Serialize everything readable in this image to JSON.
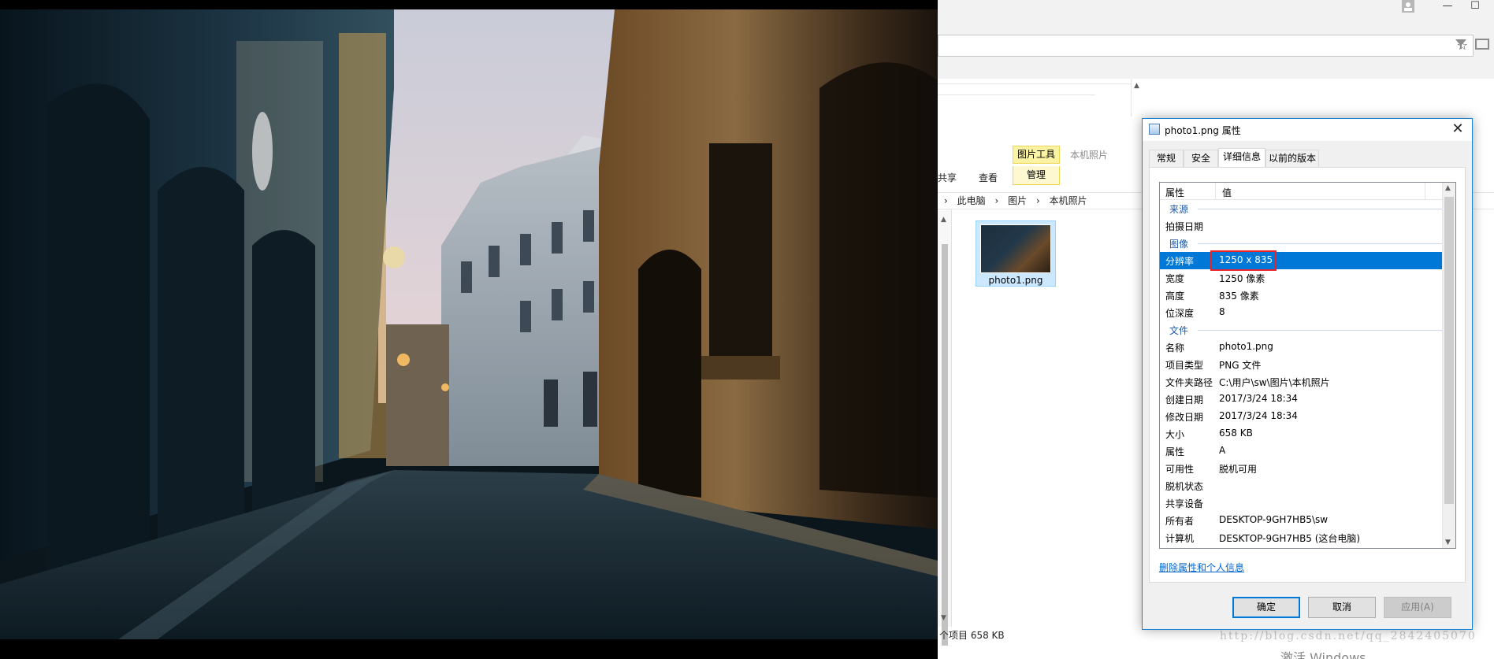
{
  "explorer": {
    "ribbon_context_group": "图片工具",
    "ribbon_context_group2": "本机照片",
    "tab_share": "共享",
    "tab_view": "查看",
    "tab_manage": "管理",
    "breadcrumb_sep": "›",
    "breadcrumb": [
      "此电脑",
      "图片",
      "本机照片"
    ],
    "file_name": "photo1.png",
    "status": "个项目  658 KB",
    "watermark": "http://blog.csdn.net/qq_2842405070",
    "activate_text": "激活 Windows"
  },
  "browser": {
    "star_icon": "☆",
    "minimize": "—",
    "maximize": "☐"
  },
  "dialog": {
    "title": "photo1.png 属性",
    "close": "✕",
    "tabs": [
      "常规",
      "安全",
      "详细信息",
      "以前的版本"
    ],
    "active_tab": "详细信息",
    "col_property": "属性",
    "col_value": "值",
    "groups": {
      "source": "来源",
      "image": "图像",
      "file": "文件"
    },
    "source_rows": [
      {
        "k": "拍摄日期",
        "v": ""
      }
    ],
    "image_rows": [
      {
        "k": "分辨率",
        "v": "1250 x 835"
      },
      {
        "k": "宽度",
        "v": "1250 像素"
      },
      {
        "k": "高度",
        "v": "835 像素"
      },
      {
        "k": "位深度",
        "v": "8"
      }
    ],
    "file_rows": [
      {
        "k": "名称",
        "v": "photo1.png"
      },
      {
        "k": "项目类型",
        "v": "PNG 文件"
      },
      {
        "k": "文件夹路径",
        "v": "C:\\用户\\sw\\图片\\本机照片"
      },
      {
        "k": "创建日期",
        "v": "2017/3/24 18:34"
      },
      {
        "k": "修改日期",
        "v": "2017/3/24 18:34"
      },
      {
        "k": "大小",
        "v": "658 KB"
      },
      {
        "k": "属性",
        "v": "A"
      },
      {
        "k": "可用性",
        "v": "脱机可用"
      },
      {
        "k": "脱机状态",
        "v": ""
      },
      {
        "k": "共享设备",
        "v": ""
      },
      {
        "k": "所有者",
        "v": "DESKTOP-9GH7HB5\\sw"
      },
      {
        "k": "计算机",
        "v": "DESKTOP-9GH7HB5 (这台电脑)"
      }
    ],
    "selected_row": "分辨率",
    "remove_link": "删除属性和个人信息",
    "buttons": {
      "ok": "确定",
      "cancel": "取消",
      "apply": "应用(A)"
    }
  },
  "colors": {
    "selection": "#0078d7",
    "highlight_box": "#e8232a",
    "group_label": "#1e5aa8",
    "link": "#0066cc",
    "ribbon_context": "#fbf3a4"
  }
}
